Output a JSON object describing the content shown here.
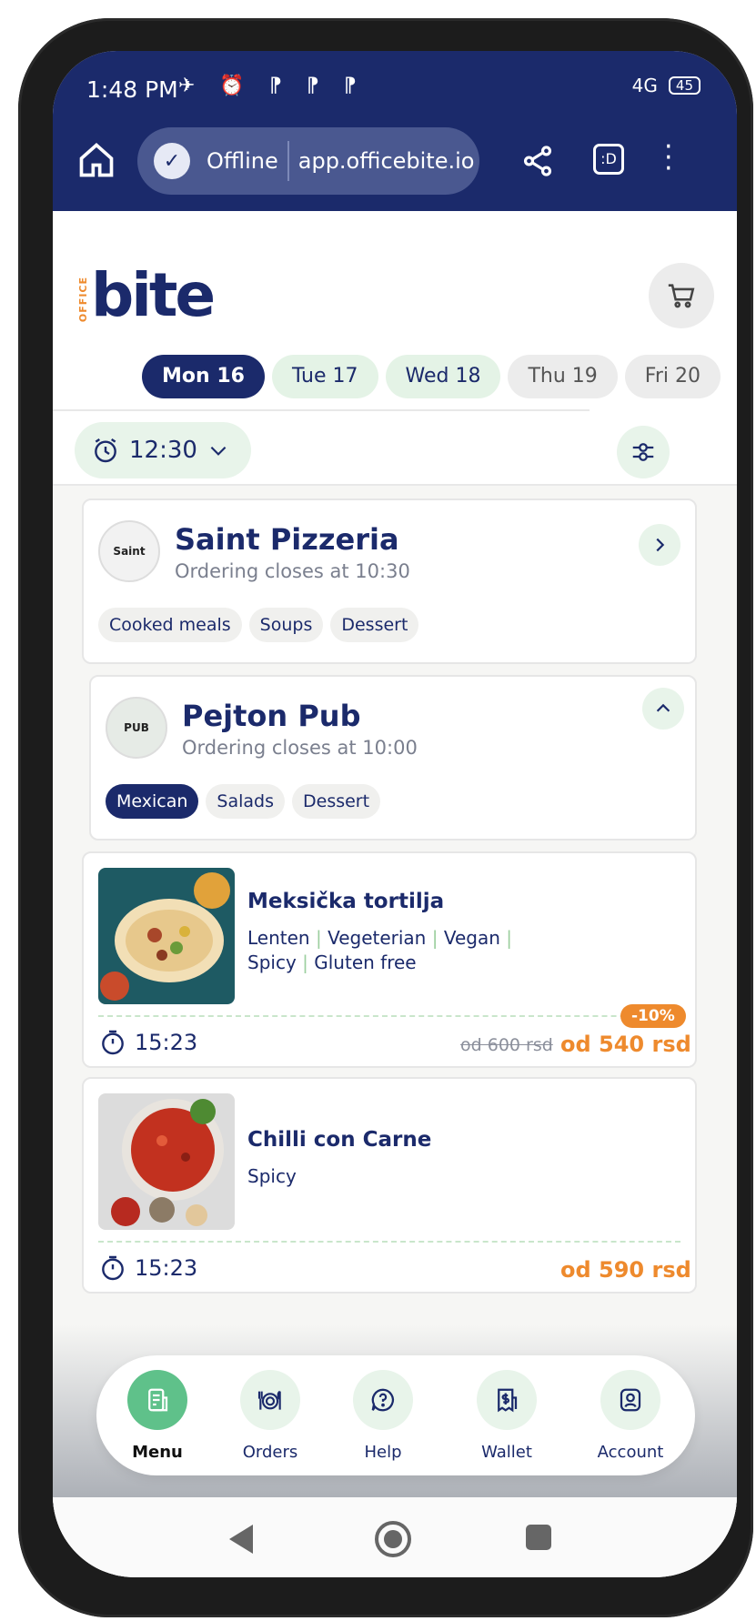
{
  "status": {
    "time": "1:48 PM",
    "signal": "4G",
    "battery": "45"
  },
  "browser": {
    "connection": "Offline",
    "url": "app.officebite.io"
  },
  "logo": {
    "small": "OFFICE",
    "main": "bite"
  },
  "days": [
    {
      "label": "Mon 16",
      "state": "active"
    },
    {
      "label": "Tue 17",
      "state": "open"
    },
    {
      "label": "Wed 18",
      "state": "open"
    },
    {
      "label": "Thu 19",
      "state": "closed"
    },
    {
      "label": "Fri 20",
      "state": "closed"
    }
  ],
  "time_filter": {
    "value": "12:30"
  },
  "restaurants": [
    {
      "name": "Saint Pizzeria",
      "closes": "Ordering closes at 10:30",
      "logo_text": "Saint",
      "tags": [
        "Cooked meals",
        "Soups",
        "Dessert"
      ]
    },
    {
      "name": "Pejton Pub",
      "closes": "Ordering closes at 10:00",
      "logo_text": "PUB",
      "tags": [
        "Mexican",
        "Salads",
        "Dessert"
      ]
    }
  ],
  "dishes": [
    {
      "name": "Meksička tortilja",
      "tags_line1": [
        "Lenten",
        "Vegeterian",
        "Vegan"
      ],
      "tags_line2": [
        "Spicy",
        "Gluten free"
      ],
      "time": "15:23",
      "old_price": "od 600 rsd",
      "price": "od 540 rsd",
      "discount": "-10%"
    },
    {
      "name": "Chilli con Carne",
      "tags_line1": [
        "Spicy"
      ],
      "time": "15:23",
      "price": "od 590 rsd"
    }
  ],
  "nav": [
    {
      "label": "Menu",
      "icon": "menu-icon"
    },
    {
      "label": "Orders",
      "icon": "orders-icon"
    },
    {
      "label": "Help",
      "icon": "help-icon"
    },
    {
      "label": "Wallet",
      "icon": "wallet-icon"
    },
    {
      "label": "Account",
      "icon": "account-icon"
    }
  ],
  "colors": {
    "navy": "#1b2a6b",
    "green": "#5fc18a",
    "orange": "#ee8a2d",
    "mint": "#e8f4ea"
  }
}
